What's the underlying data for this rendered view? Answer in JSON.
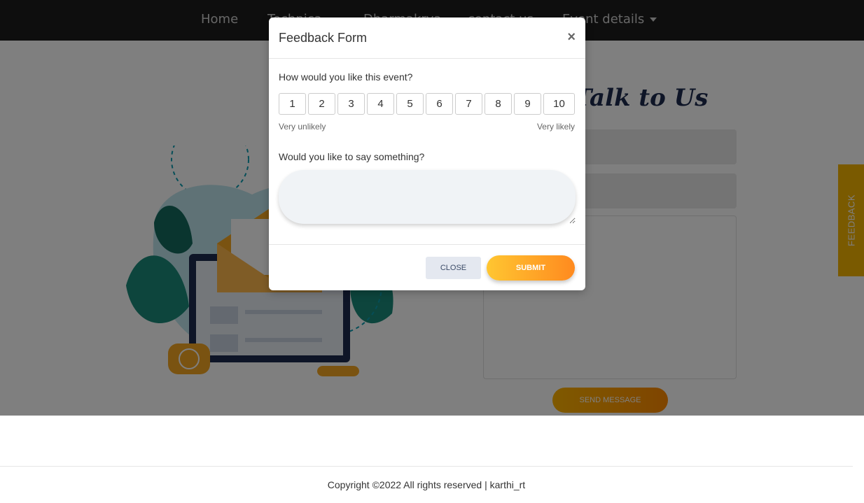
{
  "nav": {
    "items": [
      {
        "label": "Home",
        "dropdown": false
      },
      {
        "label": "Technica",
        "dropdown": true
      },
      {
        "label": "Dharmakrya",
        "dropdown": true
      },
      {
        "label": "contact us",
        "dropdown": false
      },
      {
        "label": "Event details",
        "dropdown": true
      }
    ]
  },
  "contact": {
    "title": "Talk to Us",
    "send_label": "SEND MESSAGE"
  },
  "feedback_tab": {
    "label": "FEEDBACK"
  },
  "modal": {
    "title": "Feedback Form",
    "close_symbol": "×",
    "question_rating": "How would you like this event?",
    "rating_options": [
      "1",
      "2",
      "3",
      "4",
      "5",
      "6",
      "7",
      "8",
      "9",
      "10"
    ],
    "scale_low": "Very unlikely",
    "scale_high": "Very likely",
    "question_comment": "Would you like to say something?",
    "comment_value": "",
    "close_label": "CLOSE",
    "submit_label": "SUBMIT"
  },
  "footer": {
    "text": "Copyright ©2022 All rights reserved | karthi_rt"
  },
  "colors": {
    "accent": "#ff9f1c",
    "nav_bg": "#1c1c1c"
  }
}
